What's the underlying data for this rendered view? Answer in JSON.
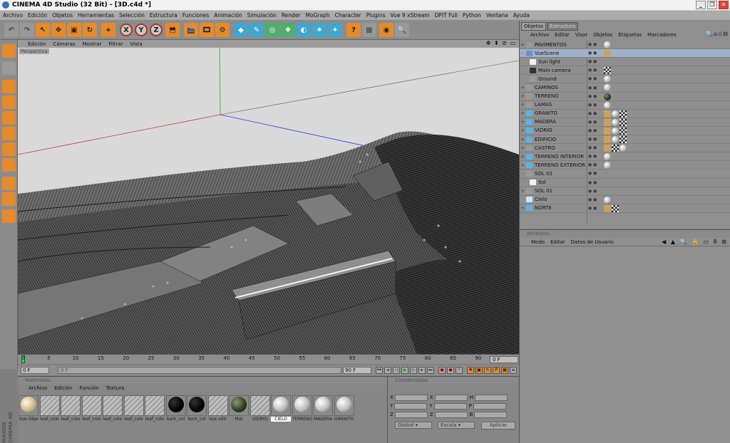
{
  "window": {
    "title": "CINEMA 4D Studio (32 Bit) - [3D.c4d *]"
  },
  "menubar": {
    "items": [
      "Archivo",
      "Edición",
      "Objetos",
      "Herramientas",
      "Selección",
      "Estructura",
      "Funciones",
      "Animación",
      "Simulación",
      "Render",
      "MoGraph",
      "Character",
      "Plugins",
      "Vue 9 xStream",
      "DPIT Full",
      "Python",
      "Ventana",
      "Ayuda"
    ]
  },
  "toolbar": {
    "axis_x": "X",
    "axis_y": "Y",
    "axis_z": "Z"
  },
  "viewport": {
    "menu": [
      "Edición",
      "Cámaras",
      "Mostrar",
      "Filtrar",
      "Vista"
    ],
    "label": "Perspectiva",
    "icons": "✥ ⬍ ⊘ ▭"
  },
  "timeline": {
    "ticks": [
      "0",
      "5",
      "10",
      "15",
      "20",
      "25",
      "30",
      "35",
      "40",
      "45",
      "50",
      "55",
      "60",
      "65",
      "70",
      "75",
      "80",
      "85",
      "90"
    ],
    "current_frame": "0 F",
    "start": "0 F",
    "preview_start": "0 F",
    "preview_end": "90 F",
    "end": "90 F"
  },
  "materials": {
    "header": "Materiales",
    "menu": [
      "Archivo",
      "Edición",
      "Función",
      "Textura"
    ],
    "items": [
      {
        "label": "Vue Obje",
        "kind": "cream"
      },
      {
        "label": "leaf_colo",
        "kind": "stripe"
      },
      {
        "label": "leaf_colo",
        "kind": "stripe"
      },
      {
        "label": "leaf_colo",
        "kind": "stripe"
      },
      {
        "label": "leaf_colo",
        "kind": "stripe"
      },
      {
        "label": "leaf_colo",
        "kind": "stripe"
      },
      {
        "label": "leaf_colo",
        "kind": "stripe"
      },
      {
        "label": "bark_col",
        "kind": "black"
      },
      {
        "label": "bark_col",
        "kind": "black"
      },
      {
        "label": "Vue xStr",
        "kind": "stripe"
      },
      {
        "label": "Mat",
        "kind": "darkgreen"
      },
      {
        "label": "VIDRIO",
        "kind": "stripe"
      },
      {
        "label": "CIELO",
        "kind": "white",
        "selected": true
      },
      {
        "label": "TERRENO",
        "kind": "white"
      },
      {
        "label": "MADERA",
        "kind": "white"
      },
      {
        "label": "GRANITO",
        "kind": "white"
      }
    ]
  },
  "brand": "MAXON CINEMA 4D",
  "coordinates": {
    "header": "Coordenadas",
    "rows": [
      [
        "X",
        "X",
        "H"
      ],
      [
        "Y",
        "Y",
        "P"
      ],
      [
        "Z",
        "Z",
        "B"
      ]
    ],
    "space": "Global",
    "mode": "Escala",
    "apply": "Aplicar"
  },
  "objects": {
    "tabs": [
      "Objetos",
      "Estructura"
    ],
    "menu": [
      "Archivo",
      "Editar",
      "Visor",
      "Objetos",
      "Etiquetas",
      "Marcadores"
    ],
    "icons": "🔍⌂◇⊟",
    "rows": [
      {
        "name": "PAVIMENTOS",
        "tree": "+",
        "icon": "null",
        "tags": [
          "ball"
        ]
      },
      {
        "name": "VueScene",
        "tree": "-",
        "icon": "vue",
        "tags": [
          "lamp"
        ]
      },
      {
        "name": "Sun light",
        "tree": "",
        "icon": "light",
        "indent": 1,
        "tags": []
      },
      {
        "name": "Main camera",
        "tree": "",
        "icon": "camera",
        "indent": 1,
        "tags": [
          "tex"
        ]
      },
      {
        "name": "Ground",
        "tree": "",
        "icon": "ground",
        "indent": 1,
        "tags": [
          "ball"
        ]
      },
      {
        "name": "CAMINOS",
        "tree": "+",
        "icon": "null",
        "tags": [
          "ball"
        ]
      },
      {
        "name": "TERRENO",
        "tree": "+",
        "icon": "null",
        "tags": [
          "dark"
        ]
      },
      {
        "name": "LAMAS",
        "tree": "+",
        "icon": "null",
        "tags": [
          "ball"
        ]
      },
      {
        "name": "GRANITO",
        "tree": "+",
        "icon": "poly",
        "tags": [
          "lamp",
          "ball",
          "tex"
        ]
      },
      {
        "name": "MADERA",
        "tree": "+",
        "icon": "poly",
        "tags": [
          "lamp",
          "ball",
          "tex"
        ]
      },
      {
        "name": "VIDRIO",
        "tree": "+",
        "icon": "poly",
        "tags": [
          "lamp",
          "ball",
          "tex"
        ]
      },
      {
        "name": "EDIFICIO",
        "tree": "+",
        "icon": "poly",
        "tags": [
          "lamp",
          "ball",
          "tex"
        ]
      },
      {
        "name": "CASTRO",
        "tree": "+",
        "icon": "null",
        "tags": [
          "lamp",
          "tex",
          "ball"
        ]
      },
      {
        "name": "TERRENO INTERIOR",
        "tree": "+",
        "icon": "poly",
        "tags": [
          "ball"
        ]
      },
      {
        "name": "TERRENO EXTERIOR",
        "tree": "+",
        "icon": "poly",
        "tags": [
          "ball"
        ]
      },
      {
        "name": "SOL 02",
        "tree": "-",
        "icon": "null",
        "tags": []
      },
      {
        "name": "Sol",
        "tree": "",
        "icon": "light",
        "indent": 1,
        "tags": []
      },
      {
        "name": "SOL 01",
        "tree": "+",
        "icon": "null",
        "tags": []
      },
      {
        "name": "Cielo",
        "tree": "",
        "icon": "sky",
        "tags": [
          "ball"
        ]
      },
      {
        "name": "NORTE",
        "tree": "+",
        "icon": "poly",
        "tags": [
          "lamp",
          "tex"
        ]
      }
    ]
  },
  "attributes": {
    "header": "Atributos",
    "menu": [
      "Modo",
      "Editar",
      "Datos de Usuario"
    ],
    "icons": "◀ ▲ 🔍 🔒 ▭ 8 ⊞"
  }
}
